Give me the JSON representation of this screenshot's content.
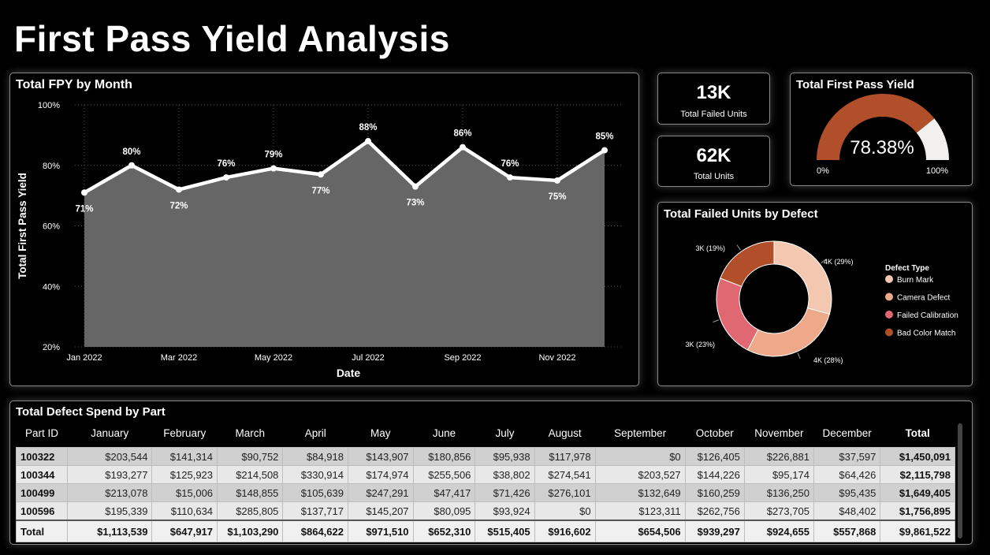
{
  "page": {
    "title": "First Pass Yield Analysis"
  },
  "colors": {
    "background": "#000000",
    "area_fill": "#666666",
    "line": "#ffffff",
    "gauge_fill": "#b04f2a",
    "gauge_rest": "#f2f0ee",
    "burn_mark": "#f4c7b0",
    "camera_defect": "#eea88a",
    "failed_calibration": "#e06873",
    "bad_color_match": "#b04f2a"
  },
  "fpy_chart": {
    "title": "Total FPY by Month",
    "chart_data": {
      "type": "area",
      "title": "Total FPY by Month",
      "xlabel": "Date",
      "ylabel": "Total First Pass Yield",
      "x": [
        "Jan 2022",
        "Feb 2022",
        "Mar 2022",
        "Apr 2022",
        "May 2022",
        "Jun 2022",
        "Jul 2022",
        "Aug 2022",
        "Sep 2022",
        "Oct 2022",
        "Nov 2022",
        "Dec 2022"
      ],
      "values": [
        71,
        80,
        72,
        76,
        79,
        77,
        88,
        73,
        86,
        76,
        75,
        85
      ],
      "data_labels": [
        "71%",
        "80%",
        "72%",
        "76%",
        "79%",
        "77%",
        "88%",
        "73%",
        "86%",
        "76%",
        "75%",
        "85%"
      ],
      "x_ticks": [
        "Jan 2022",
        "Mar 2022",
        "May 2022",
        "Jul 2022",
        "Sep 2022",
        "Nov 2022"
      ],
      "y_ticks": [
        "20%",
        "40%",
        "60%",
        "80%",
        "100%"
      ],
      "ylim": [
        20,
        100
      ],
      "grid": true
    }
  },
  "kpis": [
    {
      "value": "13K",
      "label": "Total Failed Units"
    },
    {
      "value": "62K",
      "label": "Total Units"
    }
  ],
  "gauge": {
    "title": "Total First Pass Yield",
    "value_text": "78.38%",
    "value": 78.38,
    "min_label": "0%",
    "max_label": "100%"
  },
  "defects": {
    "title": "Total Failed Units by Defect",
    "legend_title": "Defect Type",
    "chart_data": {
      "type": "pie",
      "title": "Total Failed Units by Defect",
      "categories": [
        "Burn Mark",
        "Camera Defect",
        "Failed  Calibration",
        "Bad Color Match"
      ],
      "values": [
        29,
        28,
        23,
        19
      ],
      "data_labels": [
        "4K (29%)",
        "4K (28%)",
        "3K (23%)",
        "3K (19%)"
      ],
      "legend_placement": "right"
    }
  },
  "table": {
    "title": "Total Defect Spend by Part",
    "headers": [
      "Part ID",
      "January",
      "February",
      "March",
      "April",
      "May",
      "June",
      "July",
      "August",
      "September",
      "October",
      "November",
      "December",
      "Total"
    ],
    "rows": [
      [
        "100322",
        "$203,544",
        "$141,314",
        "$90,752",
        "$84,918",
        "$143,907",
        "$180,856",
        "$95,938",
        "$117,978",
        "$0",
        "$126,405",
        "$226,881",
        "$37,597",
        "$1,450,091"
      ],
      [
        "100344",
        "$193,277",
        "$125,923",
        "$214,508",
        "$330,914",
        "$174,974",
        "$255,506",
        "$38,802",
        "$274,541",
        "$203,527",
        "$144,226",
        "$95,174",
        "$64,426",
        "$2,115,798"
      ],
      [
        "100499",
        "$213,078",
        "$15,006",
        "$148,855",
        "$105,639",
        "$247,291",
        "$47,417",
        "$71,426",
        "$276,101",
        "$132,649",
        "$160,259",
        "$136,250",
        "$95,435",
        "$1,649,405"
      ],
      [
        "100596",
        "$195,339",
        "$110,634",
        "$285,805",
        "$137,717",
        "$145,207",
        "$80,095",
        "$93,924",
        "$0",
        "$123,311",
        "$262,756",
        "$273,705",
        "$48,402",
        "$1,756,895"
      ]
    ],
    "total_row": [
      "Total",
      "$1,113,539",
      "$647,917",
      "$1,103,290",
      "$864,622",
      "$971,510",
      "$652,310",
      "$515,405",
      "$916,602",
      "$654,506",
      "$939,297",
      "$924,655",
      "$557,868",
      "$9,861,522"
    ]
  }
}
